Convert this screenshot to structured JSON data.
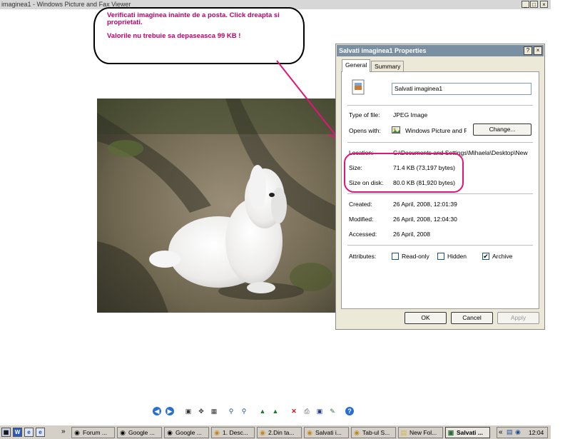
{
  "viewer": {
    "title": "imaginea1 - Windows Picture and Fax Viewer",
    "minimize": "_",
    "maximize": "□",
    "close": "×"
  },
  "note": {
    "line1": "Verificati imaginea inainte de a posta. Click dreapta si proprietati.",
    "line2": "Valorile nu trebuie sa depaseasca 99 KB !"
  },
  "dialog": {
    "title": "Salvati imaginea1 Properties",
    "help": "?",
    "close": "×",
    "tabs": [
      "General",
      "Summary"
    ],
    "filename": "Salvati imaginea1",
    "type_label": "Type of file:",
    "type_value": "JPEG Image",
    "opens_label": "Opens with:",
    "opens_value": "Windows Picture and F",
    "change_label": "Change...",
    "location_label": "Location:",
    "location_value": "C:\\Documents and Settings\\Mihaela\\Desktop\\New",
    "size_label": "Size:",
    "size_value": "71.4 KB (73,197 bytes)",
    "sizedisk_label": "Size on disk:",
    "sizedisk_value": "80.0 KB (81,920 bytes)",
    "created_label": "Created:",
    "created_value": "26 April, 2008, 12:01:39",
    "modified_label": "Modified:",
    "modified_value": "26 April, 2008, 12:04:30",
    "accessed_label": "Accessed:",
    "accessed_value": "26 April, 2008",
    "attributes_label": "Attributes:",
    "readonly_label": "Read-only",
    "readonly_checked": false,
    "hidden_label": "Hidden",
    "hidden_checked": false,
    "archive_label": "Archive",
    "archive_checked": true,
    "archive_mark": "✔",
    "ok_label": "OK",
    "cancel_label": "Cancel",
    "apply_label": "Apply"
  },
  "taskbar": {
    "start_more": "»",
    "tasks": [
      "Forum ...",
      "Google ...",
      "Google ...",
      "1. Desc...",
      "2.Din ta...",
      "Salvati i...",
      "Tab-ul S...",
      "New Fol...",
      "Salvati ..."
    ],
    "tray_more": "«",
    "clock": "12:04"
  },
  "colors": {
    "annotation": "#e0157a",
    "title_active": "#7b8fa3"
  }
}
